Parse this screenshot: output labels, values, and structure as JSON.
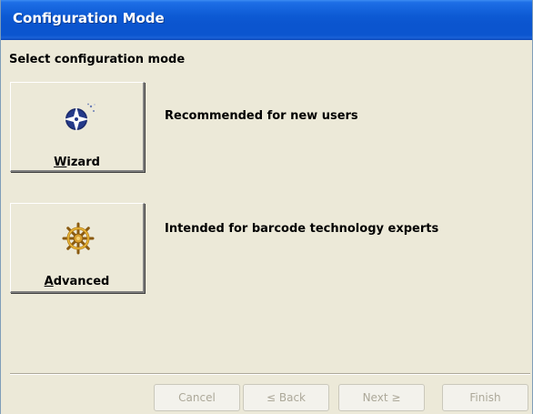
{
  "window": {
    "title": "Configuration Mode"
  },
  "main": {
    "heading": "Select configuration mode",
    "modes": [
      {
        "label_accel": "W",
        "label_rest": "izard",
        "icon": "wizard-star-icon",
        "description": "Recommended for new users"
      },
      {
        "label_accel": "A",
        "label_rest": "dvanced",
        "icon": "ship-wheel-icon",
        "description": "Intended for barcode technology experts"
      }
    ]
  },
  "footer": {
    "cancel_label": "Cancel",
    "back_label": "≤ Back",
    "next_label": "Next ≥",
    "finish_label": "Finish"
  },
  "colors": {
    "titlebar": "#0b55cf",
    "background": "#ece9d8",
    "disabled_text": "#aca899"
  }
}
